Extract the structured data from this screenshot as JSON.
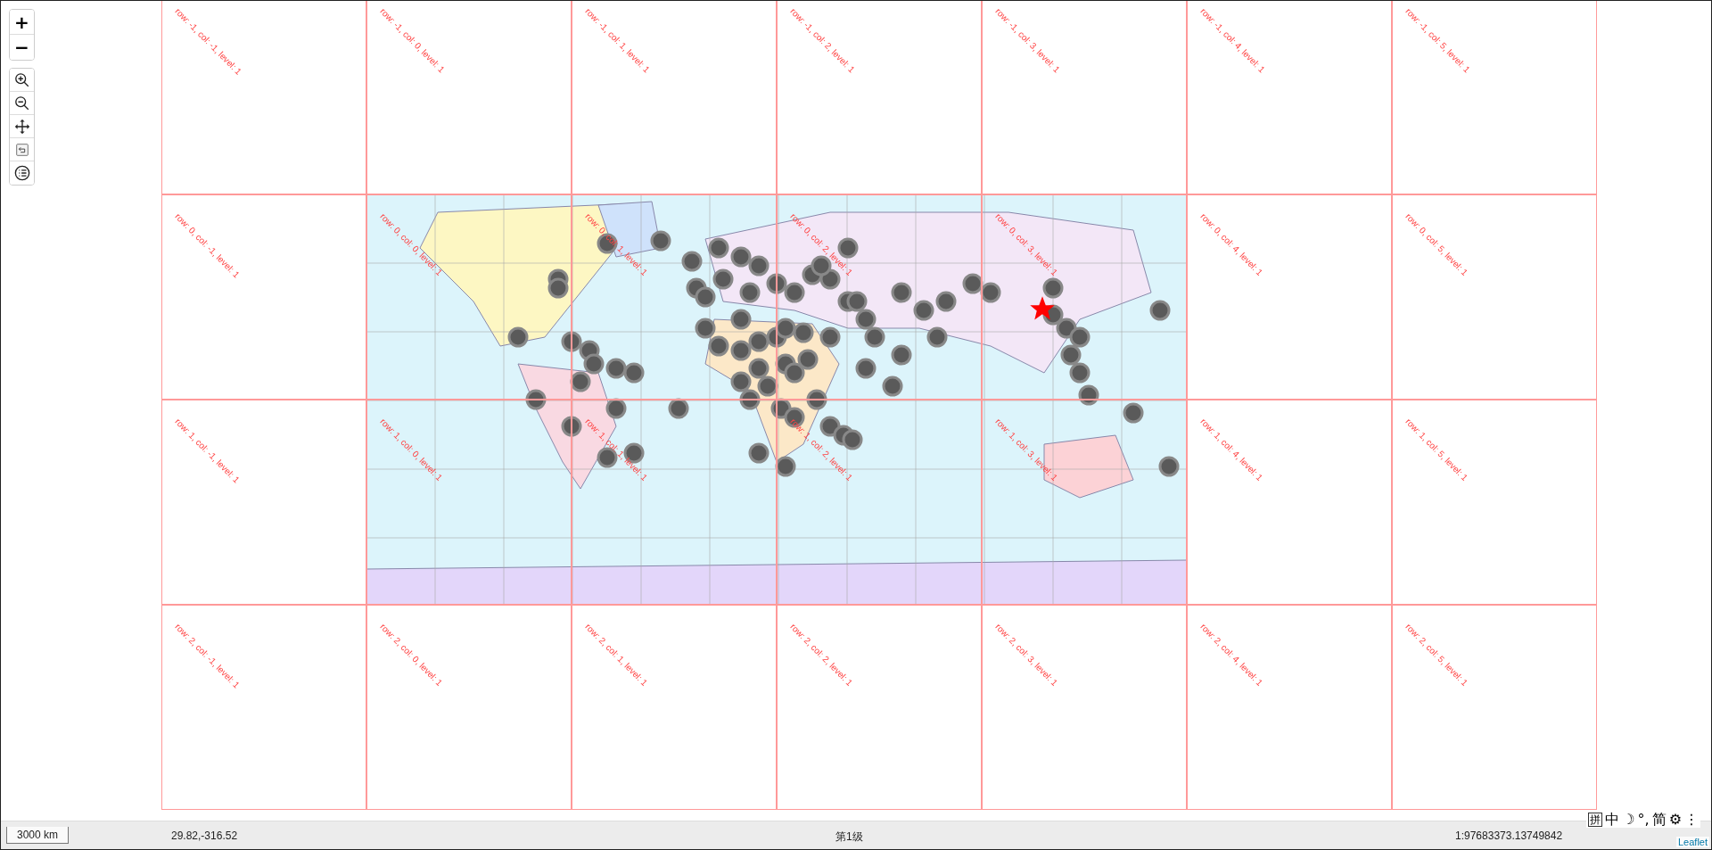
{
  "zoom_control": {
    "zoom_in": "+",
    "zoom_out": "−"
  },
  "tools": [
    {
      "kind": "zoom-in"
    },
    {
      "kind": "zoom-out"
    },
    {
      "kind": "pan"
    },
    {
      "kind": "back"
    },
    {
      "kind": "layers"
    }
  ],
  "tile_rows": [
    [
      "row: -1, col: -1, level: 1",
      "row: -1, col: 0, level: 1",
      "row: -1, col: 1, level: 1",
      "row: -1, col: 2, level: 1",
      "row: -1, col: 3, level: 1",
      "row: -1, col: 4, level: 1",
      "row: -1, col: 5, level: 1"
    ],
    [
      "row: 0, col: -1, level: 1",
      "row: 0, col: 0, level: 1",
      "row: 0, col: 1, level: 1",
      "row: 0, col: 2, level: 1",
      "row: 0, col: 3, level: 1",
      "row: 0, col: 4, level: 1",
      "row: 0, col: 5, level: 1"
    ],
    [
      "row: 1, col: -1, level: 1",
      "row: 1, col: 0, level: 1",
      "row: 1, col: 1, level: 1",
      "row: 1, col: 2, level: 1",
      "row: 1, col: 3, level: 1",
      "row: 1, col: 4, level: 1",
      "row: 1, col: 5, level: 1"
    ],
    [
      "row: 2, col: -1, level: 1",
      "row: 2, col: 0, level: 1",
      "row: 2, col: 1, level: 1",
      "row: 2, col: 2, level: 1",
      "row: 2, col: 3, level: 1",
      "row: 2, col: 4, level: 1",
      "row: 2, col: 5, level: 1"
    ]
  ],
  "status_bar": {
    "scale": "3000 km",
    "coordinates": "29.82,-316.52",
    "level": "第1级",
    "ratio": "1:97683373.13749842"
  },
  "ime_bar": [
    "拼",
    "中",
    "☽",
    "°,",
    "简",
    "⚙",
    "⋮"
  ],
  "attribution": "Leaflet"
}
